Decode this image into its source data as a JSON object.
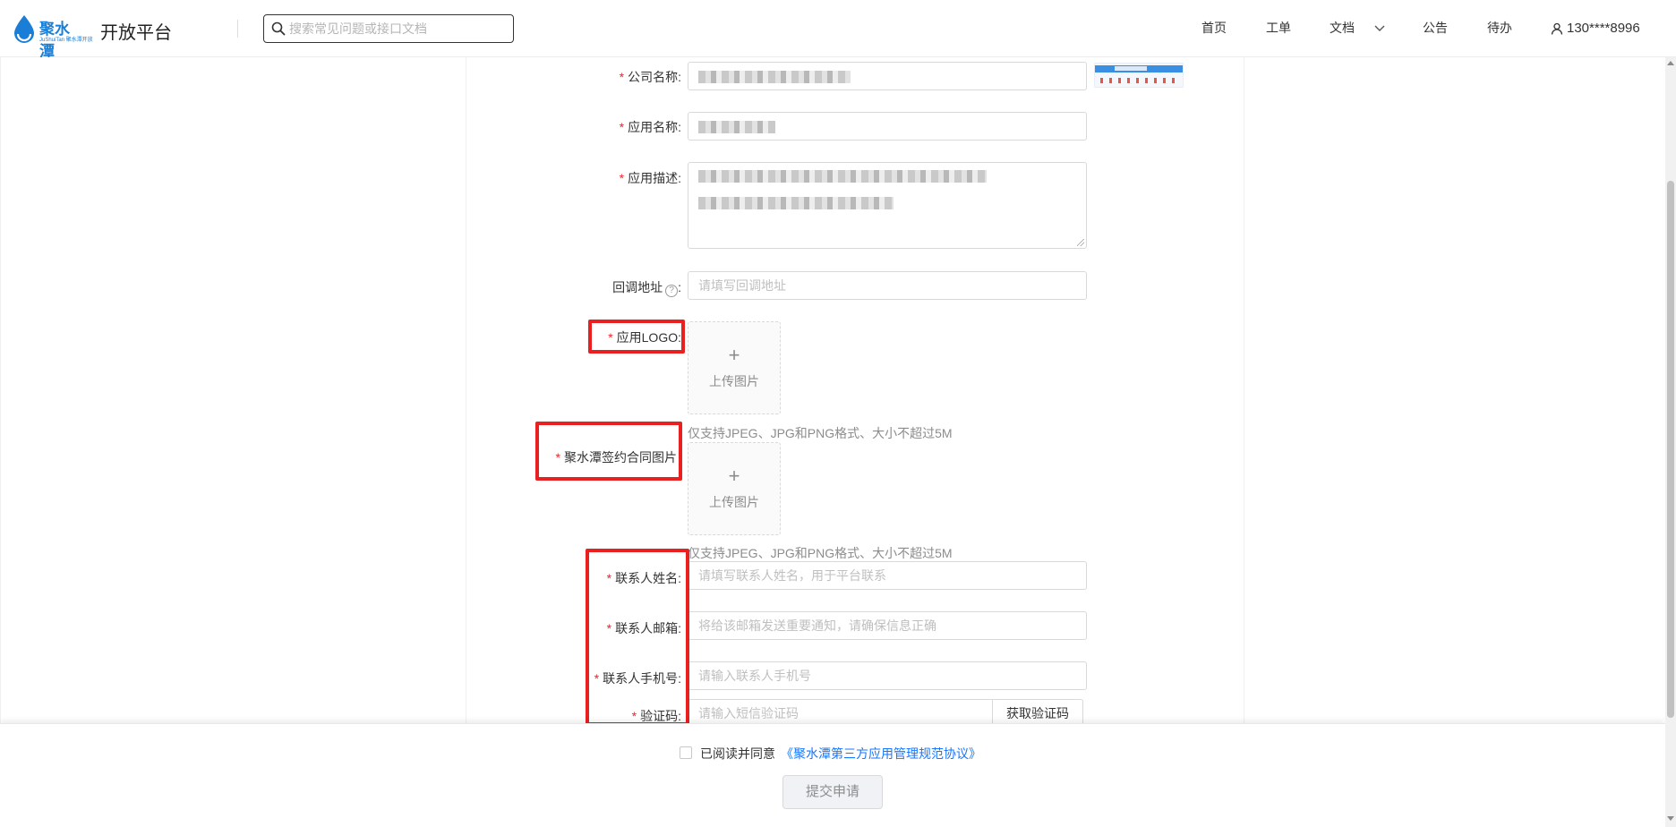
{
  "header": {
    "logo_text": "聚水潭",
    "logo_sub": "JuShuiTan 聚水潭开放",
    "platform_title": "开放平台",
    "search_placeholder": "搜索常见问题或接口文档",
    "nav": [
      {
        "label": "首页"
      },
      {
        "label": "工单"
      },
      {
        "label": "文档"
      },
      {
        "label": "公告"
      },
      {
        "label": "待办"
      }
    ],
    "user": "130****8996"
  },
  "form": {
    "company_label": "公司名称:",
    "app_name_label": "应用名称:",
    "app_desc_label": "应用描述:",
    "callback_label": "回调地址",
    "callback_colon": ":",
    "callback_placeholder": "请填写回调地址",
    "logo_label": "应用LOGO:",
    "contract_label": "聚水潭签约合同图片",
    "upload_plus": "+",
    "upload_text": "上传图片",
    "upload_hint": "仅支持JPEG、JPG和PNG格式、大小不超过5M",
    "contact_name_label": "联系人姓名:",
    "contact_name_placeholder": "请填写联系人姓名，用于平台联系",
    "contact_email_label": "联系人邮箱:",
    "contact_email_placeholder": "将给该邮箱发送重要通知，请确保信息正确",
    "contact_phone_label": "联系人手机号:",
    "contact_phone_placeholder": "请输入联系人手机号",
    "code_label": "验证码:",
    "code_placeholder": "请输入短信验证码",
    "code_button": "获取验证码",
    "required_mark": "*",
    "help_icon": "?"
  },
  "footer": {
    "agree_text": "已阅读并同意",
    "agree_link": "《聚水潭第三方应用管理规范协议》",
    "submit": "提交申请"
  },
  "colors": {
    "accent": "#1677ff",
    "required": "#f5222d",
    "highlight": "#e8201f"
  }
}
